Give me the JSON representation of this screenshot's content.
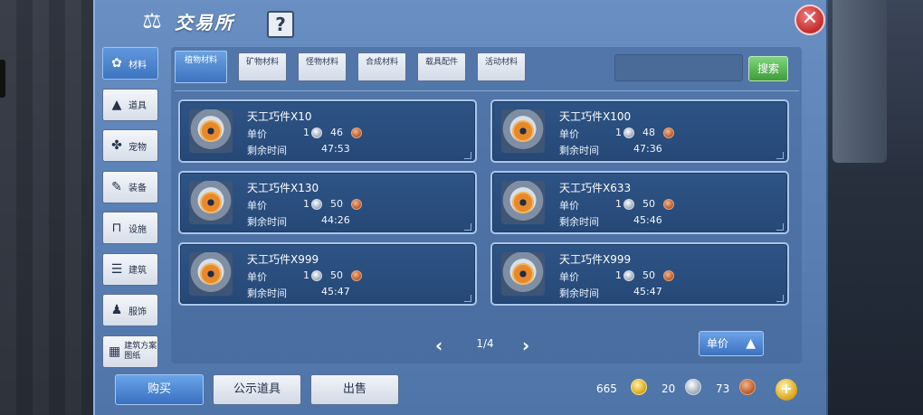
{
  "title": "交易所",
  "help_label": "?",
  "close_label": "✕",
  "sidebar": {
    "items": [
      {
        "label": "材料",
        "icon": "materials-icon",
        "glyph": "✿",
        "active": true
      },
      {
        "label": "道具",
        "icon": "flask-icon",
        "glyph": "▲",
        "active": false
      },
      {
        "label": "宠物",
        "icon": "paw-icon",
        "glyph": "✤",
        "active": false
      },
      {
        "label": "装备",
        "icon": "sword-icon",
        "glyph": "✎",
        "active": false
      },
      {
        "label": "设施",
        "icon": "facility-icon",
        "glyph": "⊓",
        "active": false
      },
      {
        "label": "建筑",
        "icon": "building-icon",
        "glyph": "☰",
        "active": false
      },
      {
        "label": "服饰",
        "icon": "clothes-icon",
        "glyph": "♟",
        "active": false
      },
      {
        "label": "建筑方案图纸",
        "icon": "blueprint-icon",
        "glyph": "▦",
        "active": false
      }
    ]
  },
  "tabs": [
    {
      "label": "植物材料",
      "active": true
    },
    {
      "label": "矿物材料",
      "active": false
    },
    {
      "label": "怪物材料",
      "active": false
    },
    {
      "label": "合成材料",
      "active": false
    },
    {
      "label": "载具配件",
      "active": false
    },
    {
      "label": "活动材料",
      "active": false
    }
  ],
  "search": {
    "placeholder": "",
    "button_label": "搜索"
  },
  "labels": {
    "price": "单价",
    "time": "剩余时间"
  },
  "listings": [
    {
      "name": "天工巧件X10",
      "silver": "1",
      "copper": "46",
      "time": "47:53"
    },
    {
      "name": "天工巧件X100",
      "silver": "1",
      "copper": "48",
      "time": "47:36"
    },
    {
      "name": "天工巧件X130",
      "silver": "1",
      "copper": "50",
      "time": "44:26"
    },
    {
      "name": "天工巧件X633",
      "silver": "1",
      "copper": "50",
      "time": "45:46"
    },
    {
      "name": "天工巧件X999",
      "silver": "1",
      "copper": "50",
      "time": "45:47"
    },
    {
      "name": "天工巧件X999",
      "silver": "1",
      "copper": "50",
      "time": "45:47"
    }
  ],
  "pager": {
    "text": "1/4",
    "prev": "‹",
    "next": "›"
  },
  "sort": {
    "label": "单价",
    "arrow": "▲"
  },
  "bottom": {
    "buy": "购买",
    "showcase": "公示道具",
    "sell": "出售"
  },
  "currency": {
    "gold": "665",
    "silver": "20",
    "copper": "73",
    "plus": "+"
  },
  "colors": {
    "panel": "#5d83b8",
    "card": "#2e5485",
    "search_button": "#3f9c3b",
    "close": "#c42b2b"
  }
}
